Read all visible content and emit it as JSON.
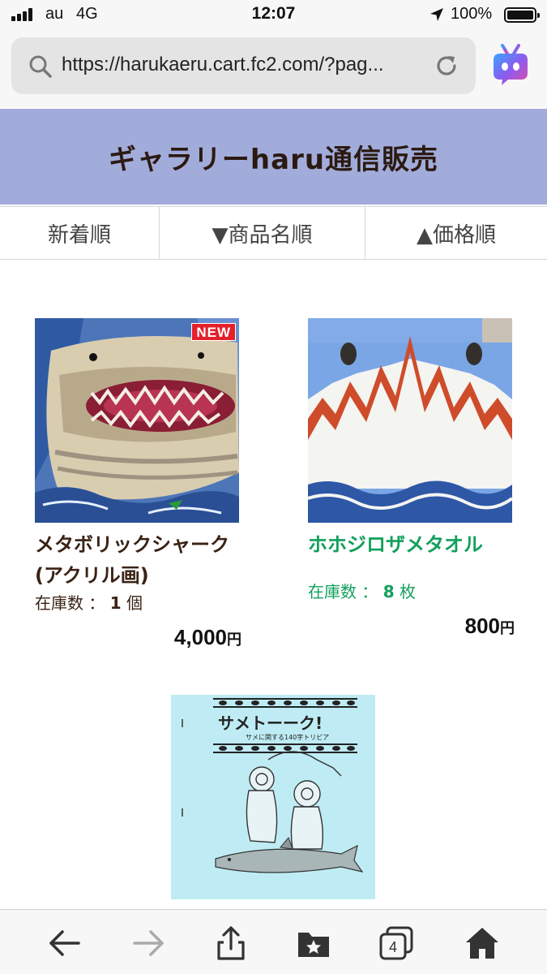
{
  "status_bar": {
    "carrier": "au",
    "network": "4G",
    "time": "12:07",
    "battery_percent": "100%",
    "icons": [
      "signal-icon",
      "location-arrow-icon",
      "battery-icon"
    ]
  },
  "browser": {
    "url": "https://harukaeru.cart.fc2.com/?pag...",
    "icons": [
      "search-icon",
      "reload-icon",
      "app-mascot-icon"
    ]
  },
  "header": {
    "title": "ギャラリーharu通信販売",
    "background_color": "#a2acdb"
  },
  "sort_tabs": [
    {
      "label": "新着順"
    },
    {
      "label": "▼商品名順"
    },
    {
      "label": "▲価格順"
    }
  ],
  "products": [
    {
      "name_line1": "メタボリックシャーク",
      "name_line2": "(アクリル画)",
      "stock_label": "在庫数 ： ",
      "stock_count": "1",
      "stock_unit": " 個",
      "price": "4,000",
      "price_unit": "円",
      "badge": "NEW",
      "name_color": "#3a2214"
    },
    {
      "name_line1": "ホホジロザメタオル",
      "stock_label": "在庫数 ： ",
      "stock_count": "8",
      "stock_unit": " 枚",
      "price": "800",
      "price_unit": "円",
      "name_color": "#12a05c"
    },
    {
      "cover_title": "サメトーーク!",
      "cover_subtitle": "サメに関する140字トリビア"
    }
  ],
  "toolbar": {
    "tab_count": "4",
    "icons": [
      "back-arrow-icon",
      "forward-arrow-icon",
      "share-icon",
      "bookmarks-icon",
      "tabs-icon",
      "home-icon"
    ]
  }
}
